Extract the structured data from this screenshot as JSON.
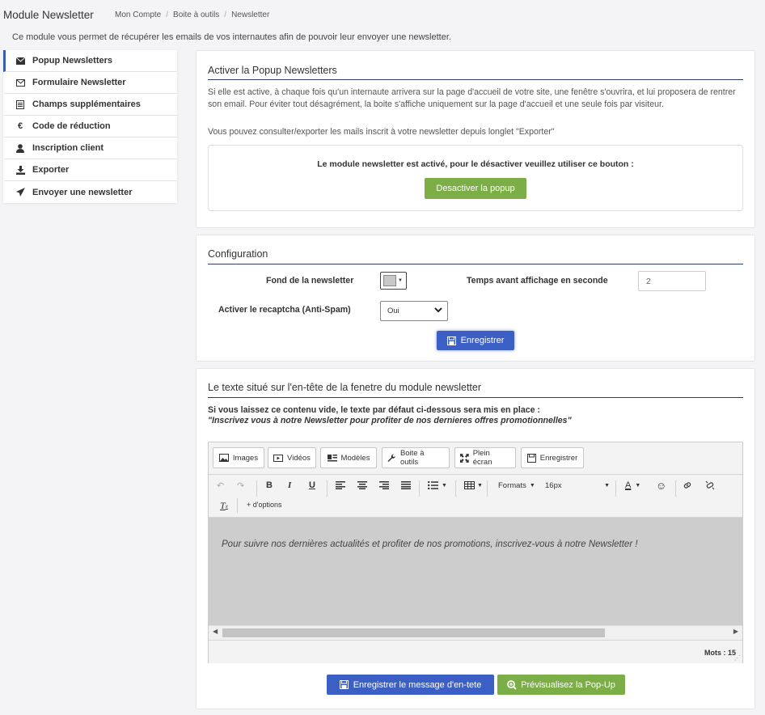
{
  "header": {
    "title": "Module Newsletter",
    "breadcrumb": [
      "Mon Compte",
      "Boite à outils",
      "Newsletter"
    ],
    "intro": "Ce module vous permet de récupérer les emails de vos internautes afin de pouvoir leur envoyer une newsletter."
  },
  "sidebar": {
    "items": [
      {
        "label": "Popup Newsletters",
        "icon": "envelope-icon",
        "active": true
      },
      {
        "label": "Formulaire Newsletter",
        "icon": "envelope-outline-icon",
        "active": false
      },
      {
        "label": "Champs supplémentaires",
        "icon": "list-icon",
        "active": false
      },
      {
        "label": "Code de réduction",
        "icon": "euro-icon",
        "active": false
      },
      {
        "label": "Inscription client",
        "icon": "user-icon",
        "active": false
      },
      {
        "label": "Exporter",
        "icon": "download-icon",
        "active": false
      },
      {
        "label": "Envoyer une newsletter",
        "icon": "paper-plane-icon",
        "active": false
      }
    ]
  },
  "popup_panel": {
    "title": "Activer la Popup Newsletters",
    "description": "Si elle est active, à chaque fois qu'un internaute arrivera sur la page d'accueil de votre site, une fenêtre s'ouvrira, et lui proposera de rentrer son email. Pour éviter tout désagrément, la boite s'affiche uniquement sur la page d'accueil et une seule fois par visiteur.",
    "export_note": "Vous pouvez consulter/exporter les mails inscrit à votre newsletter depuis longlet \"Exporter\"",
    "status_text": "Le module newsletter est activé, pour le désactiver veuillez utiliser ce bouton :",
    "deactivate_label": "Desactiver la popup"
  },
  "config_panel": {
    "title": "Configuration",
    "background_label": "Fond de la newsletter",
    "background_color": "#c8c8c8",
    "delay_label": "Temps avant affichage en seconde",
    "delay_value": "2",
    "recaptcha_label": "Activer le recaptcha (Anti-Spam)",
    "recaptcha_value": "Oui",
    "save_label": "Enregistrer"
  },
  "header_text_panel": {
    "title": "Le texte situé sur l'en-tête de la fenetre du module newsletter",
    "note_bold": "Si vous laissez ce contenu vide, le texte par défaut ci-dessous sera mis en place :",
    "note_italic": "\"Inscrivez vous à notre Newsletter pour profiter de nos dernieres offres promotionnelles\"",
    "editor": {
      "toolbar_buttons": [
        "Images",
        "Vidéos",
        "Modèles",
        "Boite à outils",
        "Plein écran",
        "Enregistrer"
      ],
      "formats_label": "Formats",
      "font_size": "16px",
      "more_options": "+ d'options",
      "content": "Pour suivre nos dernières actualités et profiter de nos promotions, inscrivez-vous à notre Newsletter !",
      "word_count": "Mots : 15"
    },
    "save_header_label": "Enregistrer le message d'en-tete",
    "preview_label": "Prévisualisez la Pop-Up"
  },
  "colors": {
    "accent_blue": "#3b5fc5",
    "accent_green": "#7cae47",
    "rule_navy": "#2e3f6e"
  }
}
